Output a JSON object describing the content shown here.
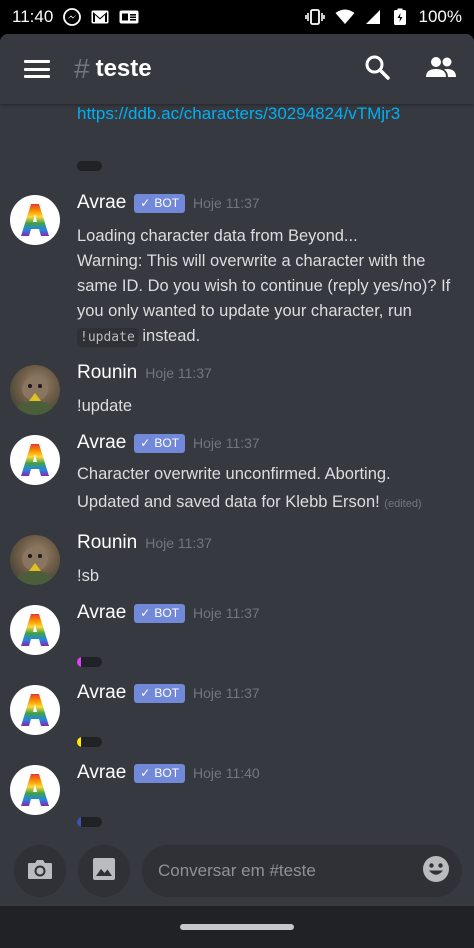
{
  "status_bar": {
    "time": "11:40",
    "battery": "100%",
    "icons": [
      "messenger-icon",
      "gmail-icon",
      "news-icon",
      "vibrate-icon",
      "wifi-icon",
      "signal-icon",
      "battery-icon"
    ]
  },
  "header": {
    "hash": "#",
    "channel": "teste",
    "icons": [
      "menu-icon",
      "search-icon",
      "members-icon"
    ]
  },
  "messages": {
    "link": "https://ddb.ac/characters/30294824/vTMjr3",
    "m1": {
      "author": "Avrae",
      "bot": "BOT",
      "time": "Hoje 11:37",
      "line1": "Loading character data from Beyond...",
      "line2a": "Warning: This will overwrite a character with the same ID. Do you wish to continue (reply yes/no)? If you only wanted to update your character, run ",
      "code": "!update",
      "line2b": " instead."
    },
    "m2": {
      "author": "Rounin",
      "time": "Hoje 11:37",
      "text": "!update"
    },
    "m3": {
      "author": "Avrae",
      "bot": "BOT",
      "time": "Hoje 11:37",
      "line1": "Character overwrite unconfirmed. Aborting.",
      "line2": "Updated and saved data for Klebb Erson! ",
      "edited": "(edited)"
    },
    "m4": {
      "author": "Rounin",
      "time": "Hoje 11:37",
      "text": "!sb"
    },
    "m5": {
      "author": "Avrae",
      "bot": "BOT",
      "time": "Hoje 11:37"
    },
    "m6": {
      "author": "Avrae",
      "bot": "BOT",
      "time": "Hoje 11:37"
    },
    "m7": {
      "author": "Avrae",
      "bot": "BOT",
      "time": "Hoje 11:40"
    }
  },
  "embed_colors": {
    "link_embed": "#202225",
    "m5": "#e040fb",
    "m6": "#ffee00",
    "m7": "#3f51b5"
  },
  "input": {
    "placeholder": "Conversar em #teste",
    "icons": [
      "camera-icon",
      "image-icon",
      "emoji-icon"
    ]
  },
  "colors": {
    "background": "#36393f",
    "link": "#00b0f4",
    "bot_tag": "#7289da",
    "timestamp": "#72767d"
  }
}
